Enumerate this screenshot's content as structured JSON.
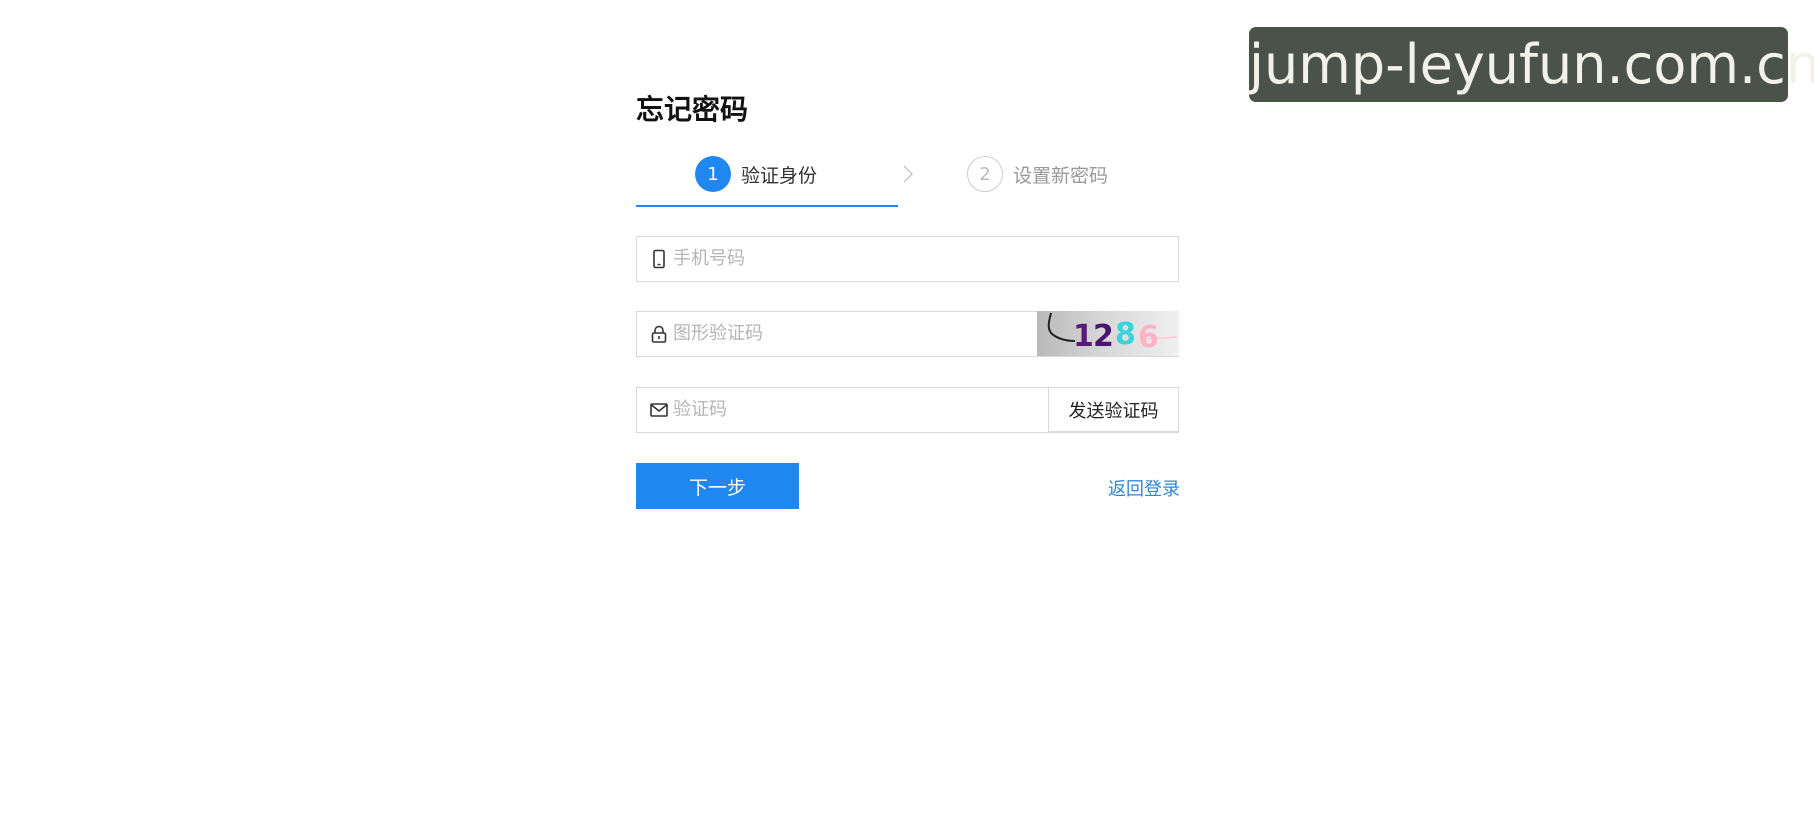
{
  "watermark": {
    "text": "jump-leyufun.com.cn"
  },
  "form": {
    "title": "忘记密码",
    "steps": [
      {
        "number": "1",
        "label": "验证身份",
        "active": true
      },
      {
        "number": "2",
        "label": "设置新密码",
        "active": false
      }
    ],
    "phone": {
      "placeholder": "手机号码",
      "icon": "mobile-phone-icon"
    },
    "captcha": {
      "placeholder": "图形验证码",
      "icon": "lock-icon",
      "image_text": "1286"
    },
    "code": {
      "placeholder": "验证码",
      "icon": "mail-icon",
      "send_label": "发送验证码"
    },
    "next_label": "下一步",
    "back_label": "返回登录"
  },
  "colors": {
    "primary": "#1e88f0",
    "link": "#2f86d6",
    "border": "#d9d9d9",
    "watermark_bg": "#4a5249"
  }
}
